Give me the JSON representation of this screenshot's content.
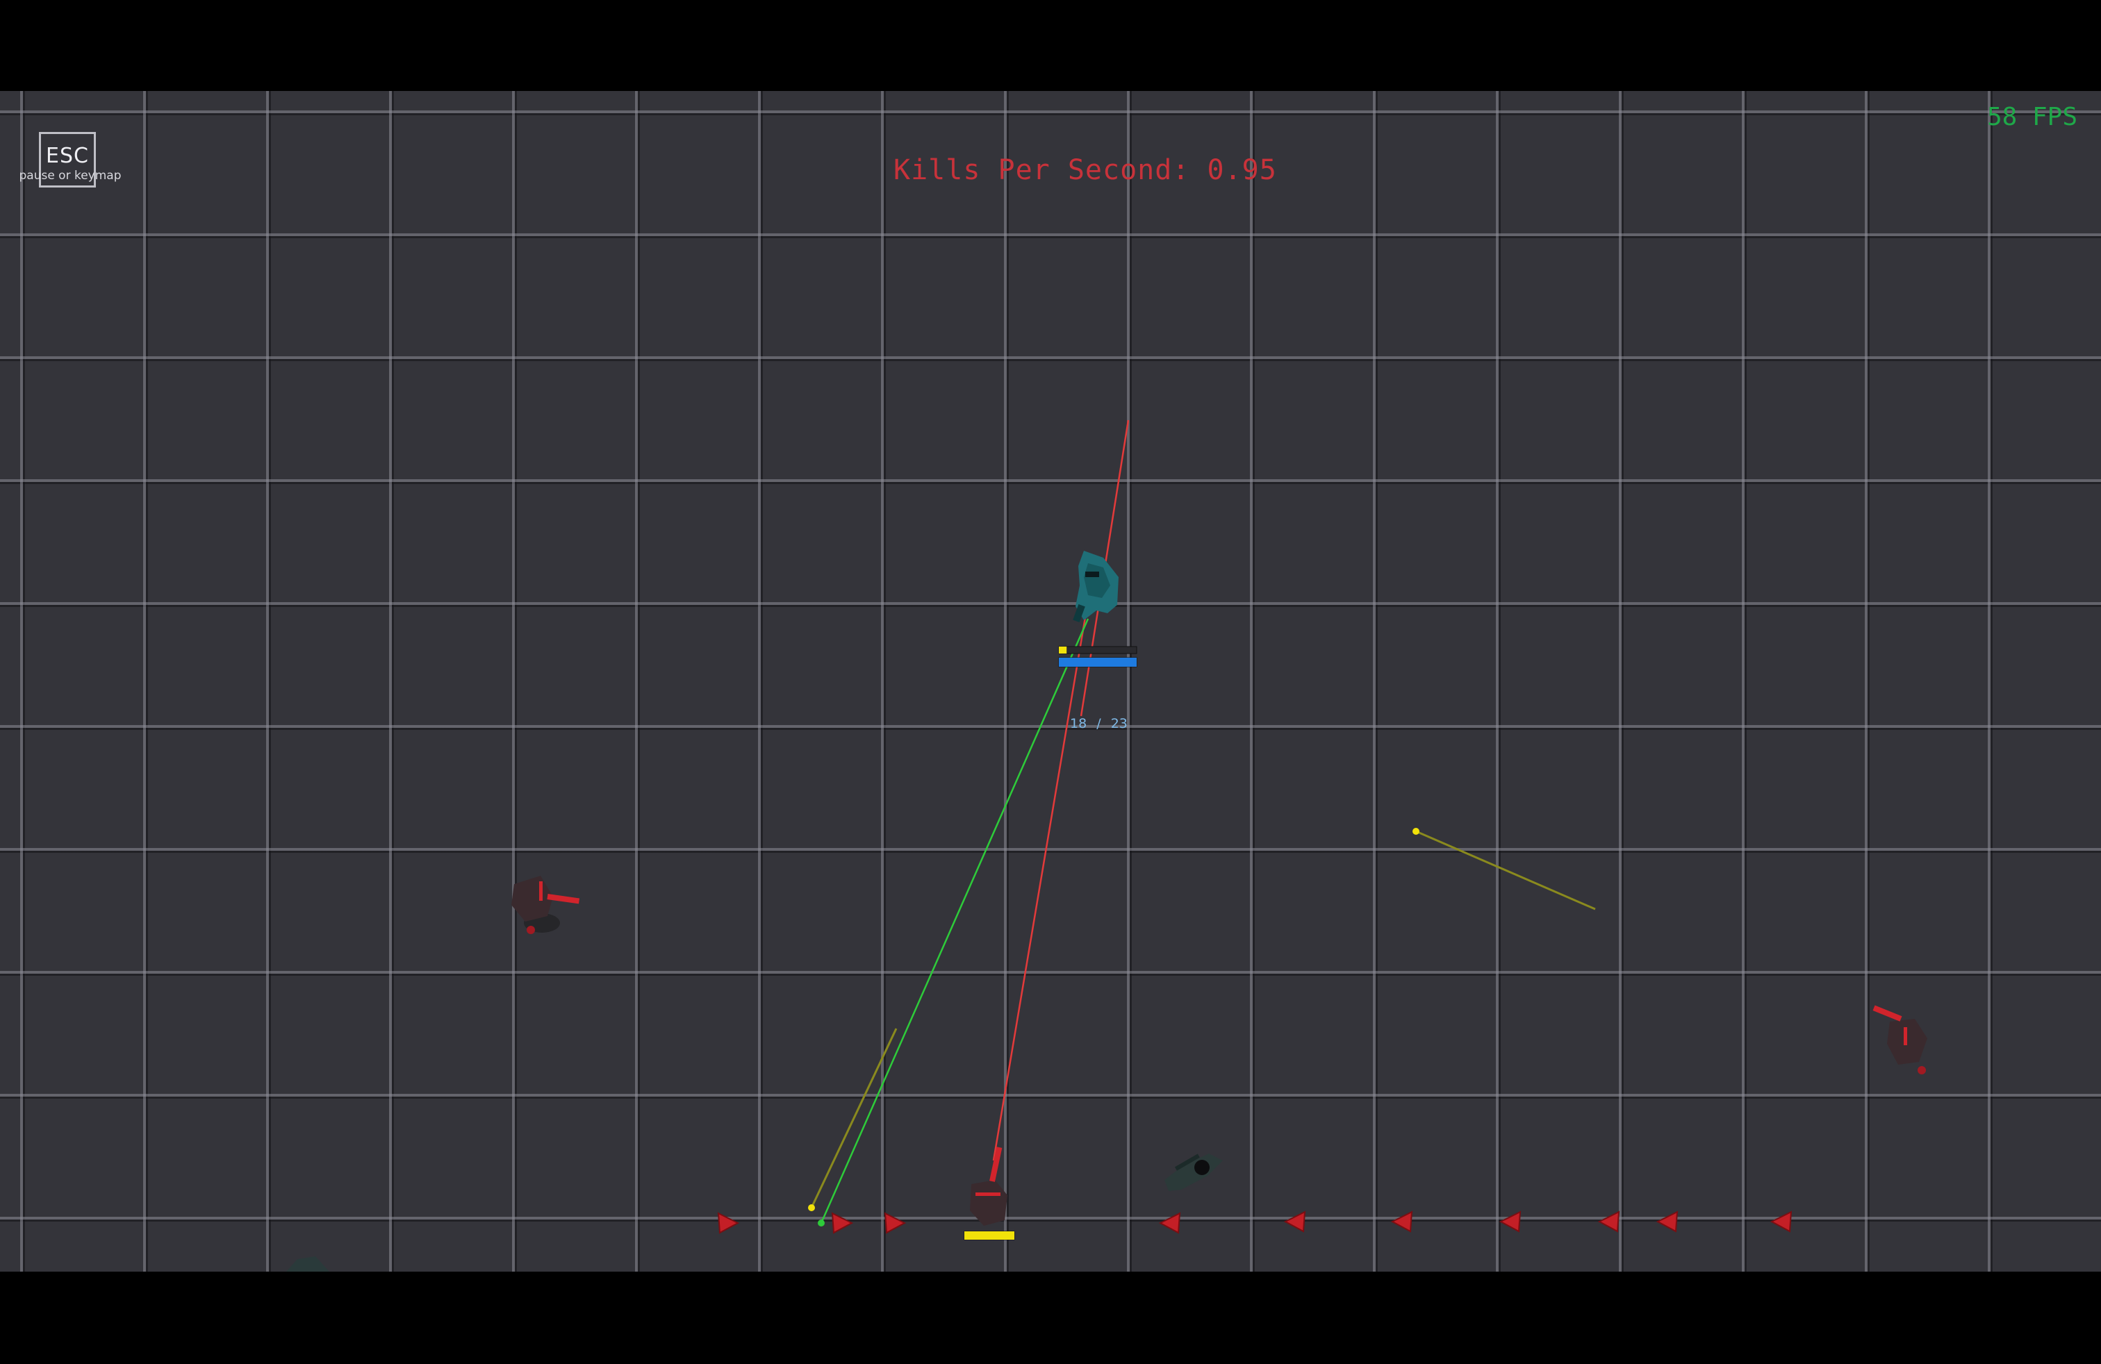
{
  "hud": {
    "esc_key": "ESC",
    "esc_hint": "pause or keymap",
    "kills_per_second": "Kills Per Second: 0.95",
    "fps": "58 FPS"
  },
  "player": {
    "ammo_current": "18",
    "ammo_separator": "/",
    "ammo_max": "23",
    "reload_fraction": 0.1,
    "health_fraction": 1.0
  },
  "enemy_bottom": {
    "health_fraction": 1.0
  },
  "colors": {
    "background": "#34343a",
    "player": "#1f6f78",
    "enemy": "#3a2a2e",
    "enemy_accent": "#d1242c",
    "laser_red": "#e23a3a",
    "laser_green": "#2ecb3a",
    "tracer_yellow": "#8a8a1e",
    "health_blue": "#1e7be0",
    "reload_yellow": "#f2e20a",
    "kps_text": "#c8323a",
    "fps_text": "#1fa849"
  }
}
